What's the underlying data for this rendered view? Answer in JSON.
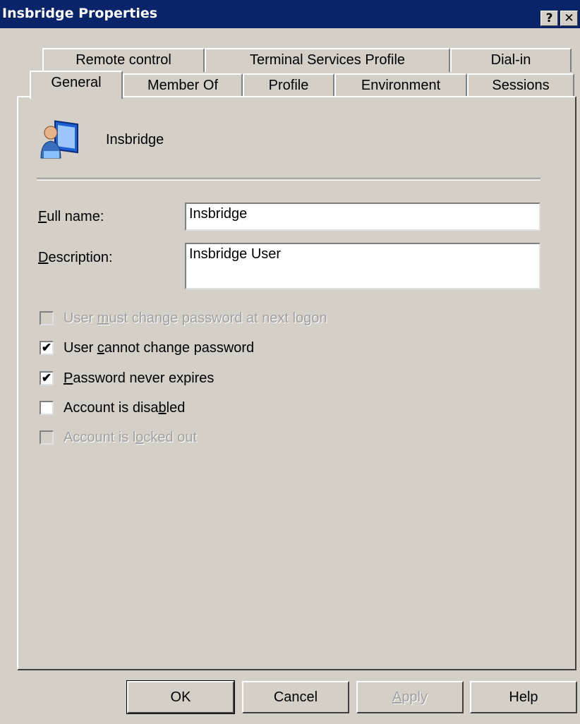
{
  "window": {
    "title": "Insbridge Properties"
  },
  "titlebar_buttons": {
    "help": "?",
    "close": "✕"
  },
  "tabs_row1": [
    "Remote control",
    "Terminal Services Profile",
    "Dial-in"
  ],
  "tabs_row2": [
    "General",
    "Member Of",
    "Profile",
    "Environment",
    "Sessions"
  ],
  "active_tab": "General",
  "user": {
    "display_name": "Insbridge",
    "icon": "user-computer-icon"
  },
  "form": {
    "full_name_label": "Full name:",
    "full_name_value": "Insbridge",
    "description_label": "Description:",
    "description_value": "Insbridge User"
  },
  "checkboxes": [
    {
      "label": "User must change password at next logon",
      "checked": false,
      "enabled": false
    },
    {
      "label": "User cannot change password",
      "checked": true,
      "enabled": true
    },
    {
      "label": "Password never expires",
      "checked": true,
      "enabled": true
    },
    {
      "label": "Account is disabled",
      "checked": false,
      "enabled": true
    },
    {
      "label": "Account is locked out",
      "checked": false,
      "enabled": false
    }
  ],
  "buttons": {
    "ok": "OK",
    "cancel": "Cancel",
    "apply": "Apply",
    "help": "Help"
  }
}
